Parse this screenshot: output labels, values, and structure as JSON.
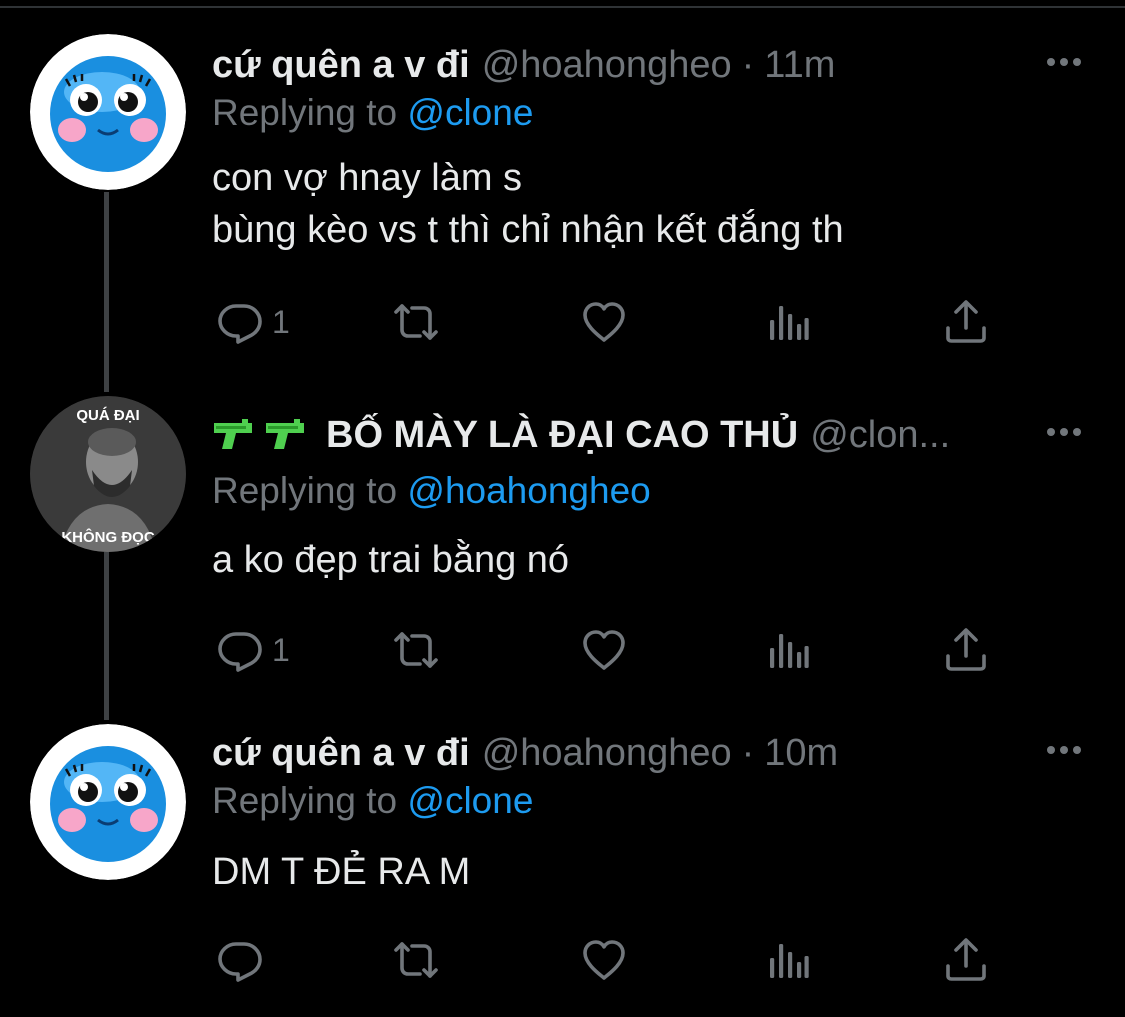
{
  "tweets": [
    {
      "display_name": "cứ quên a v đi",
      "handle": "@hoahongheo",
      "separator": "·",
      "time": "11m",
      "replying_prefix": "Replying to",
      "replying_to": "@clone",
      "text": "con vợ hnay làm s\nbùng kèo vs t thì chỉ nhận kết đắng th",
      "reply_count": "1"
    },
    {
      "display_name": "BỐ MÀY LÀ ĐẠI CAO THỦ",
      "handle": "@clon...",
      "replying_prefix": "Replying to",
      "replying_to": "@hoahongheo",
      "text": "a ko đẹp trai bằng nó",
      "reply_count": "1",
      "avatar_top_text": "QUÁ ĐẠI",
      "avatar_bottom_text": "KHÔNG ĐỌC"
    },
    {
      "display_name": "cứ quên a v đi",
      "handle": "@hoahongheo",
      "separator": "·",
      "time": "10m",
      "replying_prefix": "Replying to",
      "replying_to": "@clone",
      "text": "DM T ĐẺ RA M",
      "reply_count": ""
    }
  ],
  "icons": {
    "reply": "reply-icon",
    "retweet": "retweet-icon",
    "like": "heart-icon",
    "views": "views-icon",
    "share": "share-icon",
    "more": "more-icon",
    "name_emoji": "water-pistol-icon"
  },
  "colors": {
    "background": "#000000",
    "text": "#e7e9ea",
    "secondary": "#71767b",
    "accent": "#1d9bf0",
    "thread_line": "#3e4144"
  }
}
